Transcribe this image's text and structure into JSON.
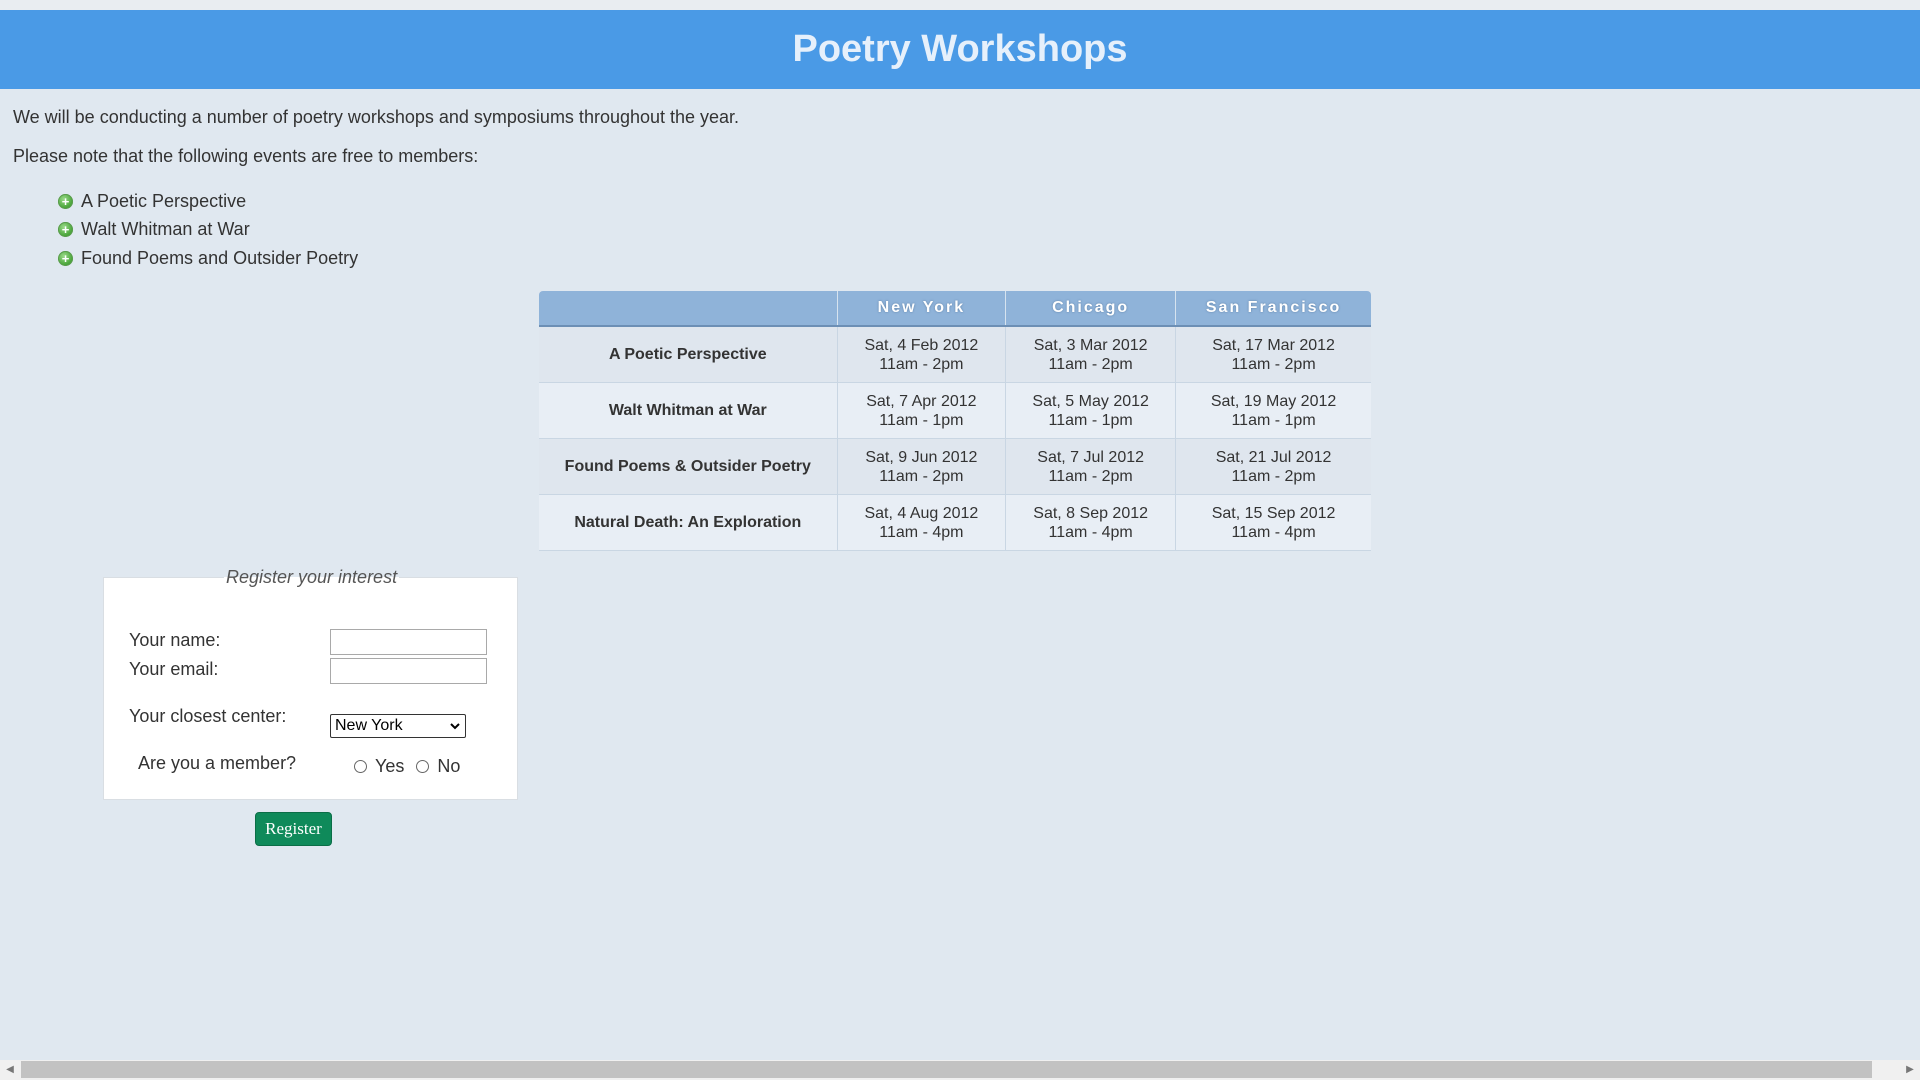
{
  "header": {
    "title": "Poetry Workshops"
  },
  "intro": {
    "line1": "We will be conducting a number of poetry workshops and symposiums throughout the year.",
    "line2": "Please note that the following events are free to members:"
  },
  "free_events": [
    {
      "label": "A Poetic Perspective"
    },
    {
      "label": "Walt Whitman at War"
    },
    {
      "label": "Found Poems and Outsider Poetry"
    }
  ],
  "schedule": {
    "columns": [
      "",
      "New York",
      "Chicago",
      "San Francisco"
    ],
    "rows": [
      {
        "event": "A Poetic Perspective",
        "cells": [
          {
            "date": "Sat, 4 Feb 2012",
            "time": "11am - 2pm"
          },
          {
            "date": "Sat, 3 Mar 2012",
            "time": "11am - 2pm"
          },
          {
            "date": "Sat, 17 Mar 2012",
            "time": "11am - 2pm"
          }
        ]
      },
      {
        "event": "Walt Whitman at War",
        "cells": [
          {
            "date": "Sat, 7 Apr 2012",
            "time": "11am - 1pm"
          },
          {
            "date": "Sat, 5 May 2012",
            "time": "11am - 1pm"
          },
          {
            "date": "Sat, 19 May 2012",
            "time": "11am - 1pm"
          }
        ]
      },
      {
        "event": "Found Poems & Outsider Poetry",
        "cells": [
          {
            "date": "Sat, 9 Jun 2012",
            "time": "11am - 2pm"
          },
          {
            "date": "Sat, 7 Jul 2012",
            "time": "11am - 2pm"
          },
          {
            "date": "Sat, 21 Jul 2012",
            "time": "11am - 2pm"
          }
        ]
      },
      {
        "event": "Natural Death: An Exploration",
        "cells": [
          {
            "date": "Sat, 4 Aug 2012",
            "time": "11am - 4pm"
          },
          {
            "date": "Sat, 8 Sep 2012",
            "time": "11am - 4pm"
          },
          {
            "date": "Sat, 15 Sep 2012",
            "time": "11am - 4pm"
          }
        ]
      }
    ]
  },
  "form": {
    "legend": "Register your interest",
    "name_label": "Your name:",
    "name_value": "",
    "email_label": "Your email:",
    "email_value": "",
    "center_label": "Your closest center:",
    "center_value": "New York",
    "member_label": "Are you a member?",
    "member_yes": "Yes",
    "member_no": "No",
    "submit_label": "Register"
  },
  "colors": {
    "header_bg": "#4a9ae6",
    "page_bg": "#e0e8f0",
    "button_bg": "#0f8a5a",
    "table_header_bg": "#8fb3d9"
  },
  "icons": {
    "list_bullet": "plus-circle-icon",
    "select_arrow": "chevron-down-icon",
    "scroll_left": "arrow-left-icon",
    "scroll_right": "arrow-right-icon"
  }
}
